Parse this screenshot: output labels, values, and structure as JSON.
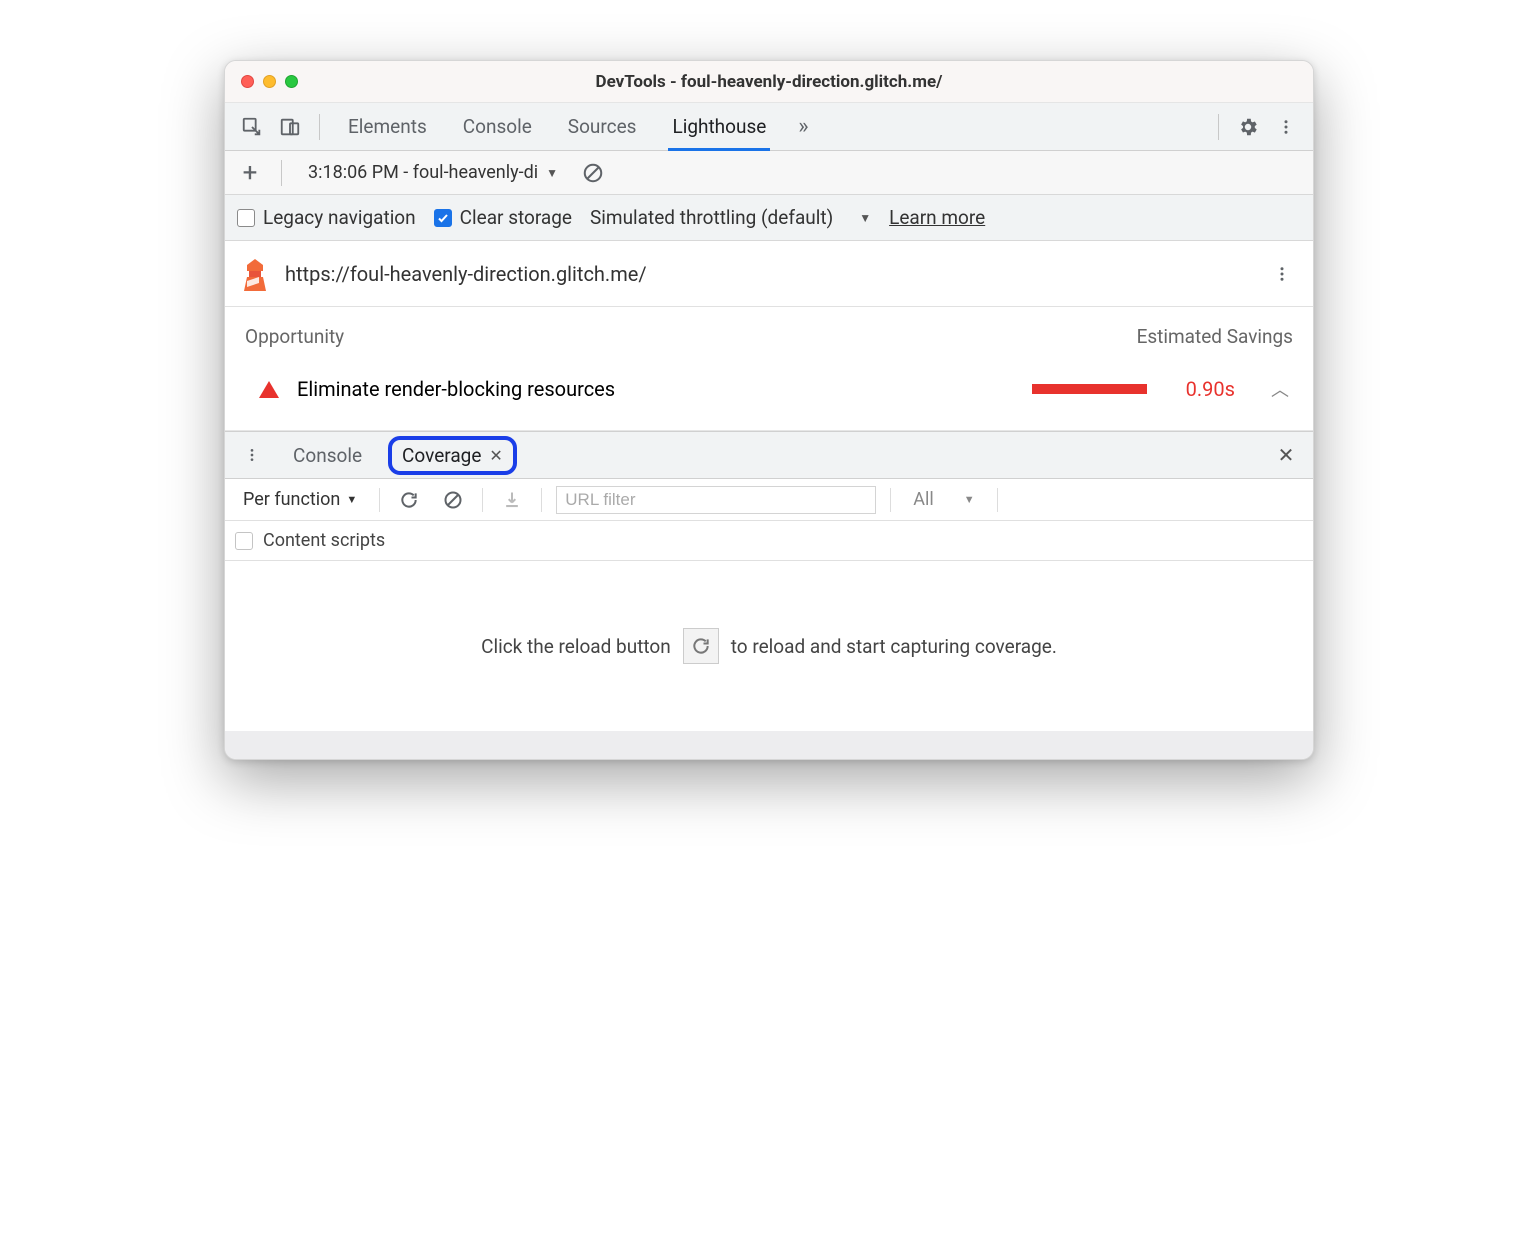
{
  "window": {
    "title": "DevTools - foul-heavenly-direction.glitch.me/"
  },
  "tabs": {
    "items": [
      "Elements",
      "Console",
      "Sources",
      "Lighthouse"
    ],
    "active": "Lighthouse"
  },
  "lighthouse_toolbar": {
    "run_selector": "3:18:06 PM - foul-heavenly-di"
  },
  "options": {
    "legacy_label": "Legacy navigation",
    "legacy_checked": false,
    "clear_label": "Clear storage",
    "clear_checked": true,
    "throttling_label": "Simulated throttling (default)",
    "learn_more": "Learn more"
  },
  "report": {
    "url": "https://foul-heavenly-direction.glitch.me/",
    "head_opportunity": "Opportunity",
    "head_savings": "Estimated Savings",
    "item_label": "Eliminate render-blocking resources",
    "item_savings": "0.90s"
  },
  "drawer": {
    "tabs": [
      "Console",
      "Coverage"
    ],
    "active": "Coverage"
  },
  "coverage": {
    "granularity": "Per function",
    "filter_placeholder": "URL filter",
    "type_filter": "All",
    "content_scripts_label": "Content scripts",
    "hint_pre": "Click the reload button",
    "hint_post": "to reload and start capturing coverage."
  }
}
